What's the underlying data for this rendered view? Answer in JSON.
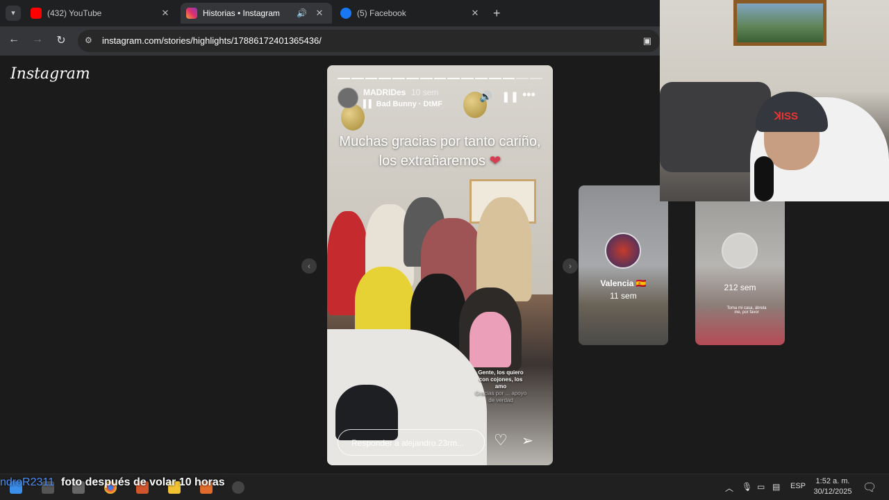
{
  "browser": {
    "tabs": [
      {
        "title": "(432) YouTube",
        "favicon": "youtube-icon",
        "color": "#ff0000",
        "active": false
      },
      {
        "title": "Historias • Instagram",
        "favicon": "instagram-icon",
        "color": "#e1306c",
        "active": true
      },
      {
        "title": "(5) Facebook",
        "favicon": "facebook-icon",
        "color": "#1877f2",
        "active": false
      }
    ],
    "new_tab_label": "+",
    "url": "instagram.com/stories/highlights/17886172401365436/"
  },
  "instagram": {
    "logo": "Instagram",
    "story": {
      "username": "MADRIDes",
      "time": "10 sem",
      "music": "Bad Bunny · DtMF",
      "caption_line1": "Muchas gracias por tanto cariño,",
      "caption_line2": "los extrañaremos",
      "caption_emoji": "❤",
      "sticker_line1": "Gente, los quiero",
      "sticker_line2": "con cojones, los",
      "sticker_line3": "amo",
      "sticker_faint": "Gracias por ... apoyo de verdad",
      "reply_placeholder": "Responder a alejandro.23rm...",
      "progress_segments_done": 13,
      "progress_segments_total": 15
    },
    "previews": [
      {
        "name": "Valencia 🇪🇸",
        "time": "11 sem"
      },
      {
        "name": "",
        "time": "212 sem",
        "sticker": "Toma mi casa, ábrela me, por favor"
      }
    ]
  },
  "stream_overlay": {
    "chat_user": "ndroR2311",
    "chat_message": "foto después de volar 10 horas"
  },
  "taskbar": {
    "language": "ESP",
    "time": "1:52 a. m.",
    "date": "30/12/2025"
  }
}
